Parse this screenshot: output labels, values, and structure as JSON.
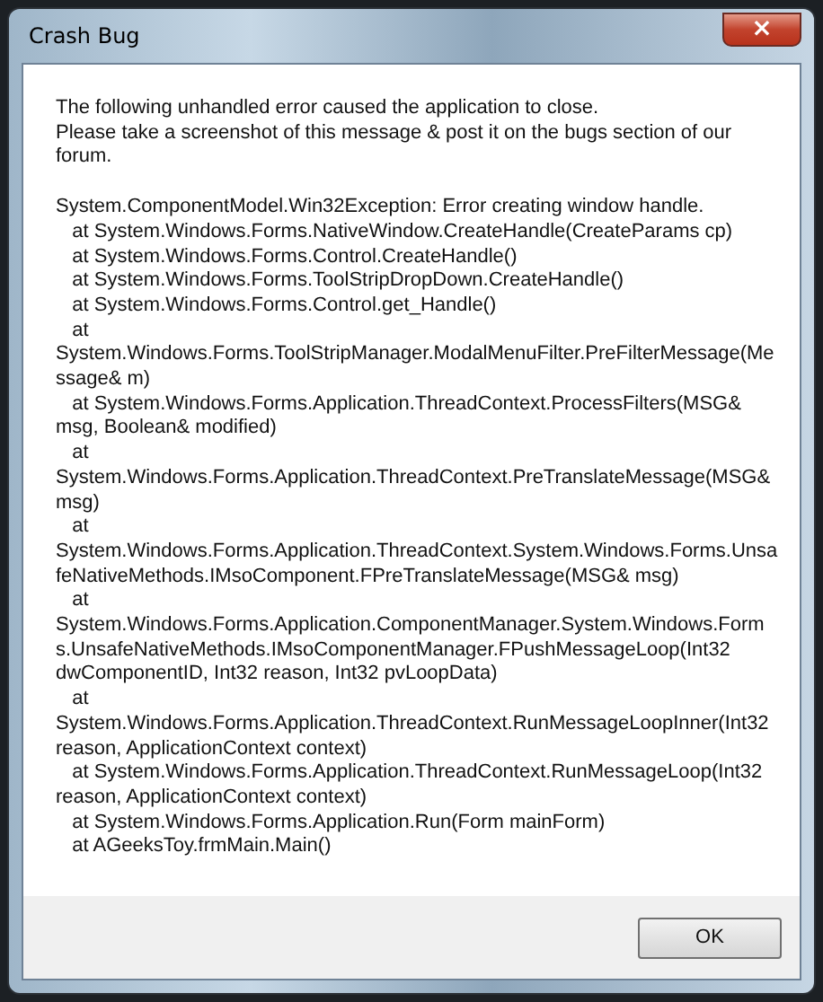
{
  "window": {
    "title": "Crash Bug",
    "close_label": "×"
  },
  "message": "The following unhandled error caused the application to close.\nPlease take a screenshot of this message & post it on the bugs section of our\nforum.",
  "stack_trace": "System.ComponentModel.Win32Exception: Error creating window handle.\n   at System.Windows.Forms.NativeWindow.CreateHandle(CreateParams cp)\n   at System.Windows.Forms.Control.CreateHandle()\n   at System.Windows.Forms.ToolStripDropDown.CreateHandle()\n   at System.Windows.Forms.Control.get_Handle()\n   at\nSystem.Windows.Forms.ToolStripManager.ModalMenuFilter.PreFilterMessage(Me\nssage& m)\n   at System.Windows.Forms.Application.ThreadContext.ProcessFilters(MSG&\nmsg, Boolean& modified)\n   at\nSystem.Windows.Forms.Application.ThreadContext.PreTranslateMessage(MSG&\nmsg)\n   at\nSystem.Windows.Forms.Application.ThreadContext.System.Windows.Forms.Unsa\nfeNativeMethods.IMsoComponent.FPreTranslateMessage(MSG& msg)\n   at\nSystem.Windows.Forms.Application.ComponentManager.System.Windows.Form\ns.UnsafeNativeMethods.IMsoComponentManager.FPushMessageLoop(Int32\ndwComponentID, Int32 reason, Int32 pvLoopData)\n   at\nSystem.Windows.Forms.Application.ThreadContext.RunMessageLoopInner(Int32\nreason, ApplicationContext context)\n   at System.Windows.Forms.Application.ThreadContext.RunMessageLoop(Int32\nreason, ApplicationContext context)\n   at System.Windows.Forms.Application.Run(Form mainForm)\n   at AGeeksToy.frmMain.Main()",
  "buttons": [
    "OK"
  ]
}
